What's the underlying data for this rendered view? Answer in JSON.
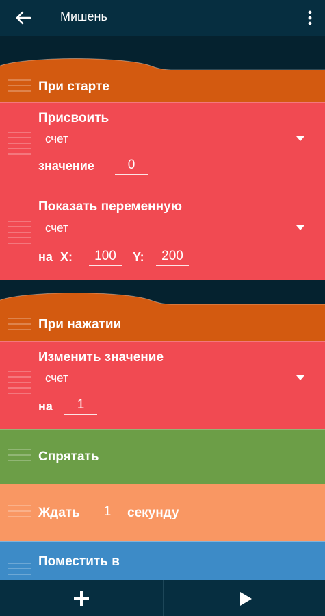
{
  "header": {
    "title": "Мишень"
  },
  "blocks": {
    "on_start": {
      "label": "При старте"
    },
    "assign": {
      "label": "Присвоить",
      "variable": "счет",
      "value_label": "значение",
      "value": "0"
    },
    "show_variable": {
      "label": "Показать переменную",
      "variable": "счет",
      "pos_label": "на",
      "x_label": "X:",
      "x_value": "100",
      "y_label": "Y:",
      "y_value": "200"
    },
    "on_tap": {
      "label": "При нажатии"
    },
    "change_value": {
      "label": "Изменить значение",
      "variable": "счет",
      "by_label": "на",
      "by_value": "1"
    },
    "hide": {
      "label": "Спрятать"
    },
    "wait": {
      "label": "Ждать",
      "value": "1",
      "unit": "секунду"
    },
    "move_to": {
      "label": "Поместить в"
    }
  },
  "colors": {
    "event": "#d35a10",
    "variable": "#f14a52",
    "looks": "#6c9e47",
    "control": "#f99763",
    "motion": "#3d8bc7",
    "bar": "#062e40"
  }
}
